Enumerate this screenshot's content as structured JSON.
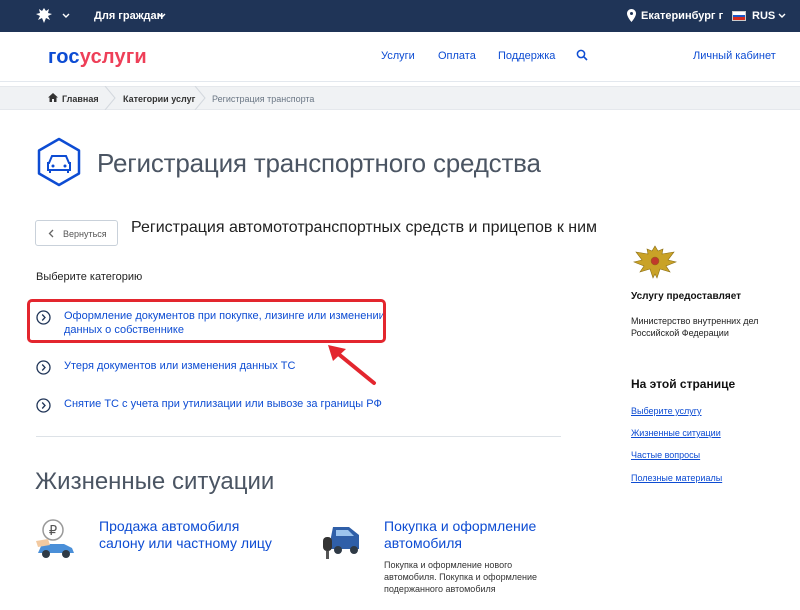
{
  "topbar": {
    "for_citizens": "Для граждан",
    "city": "Екатеринбург г",
    "lang": "RUS"
  },
  "header": {
    "logo_part1": "гос",
    "logo_part2": "услуги",
    "nav": [
      "Услуги",
      "Оплата",
      "Поддержка"
    ],
    "cabinet": "Личный кабинет"
  },
  "breadcrumb": [
    "Главная",
    "Категории услуг",
    "Регистрация транспорта"
  ],
  "page": {
    "title": "Регистрация транспортного средства",
    "back_label": "Вернуться",
    "subtitle": "Регистрация автомототранспортных средств и прицепов к ним",
    "choose_label": "Выберите категорию",
    "options": [
      {
        "line1": "Оформление документов при покупке, лизинге или изменении",
        "line2": "данных о собственнике"
      },
      {
        "line1": "Утеря документов или изменения данных ТС",
        "line2": ""
      },
      {
        "line1": "Снятие ТС с учета при утилизации или вывозе за границы РФ",
        "line2": ""
      }
    ],
    "life_title": "Жизненные ситуации",
    "cards": [
      {
        "title1": "Продажа автомобиля",
        "title2": "салону или частному лицу",
        "desc": [
          "",
          "",
          ""
        ]
      },
      {
        "title1": "Покупка и оформление",
        "title2": "автомобиля",
        "desc": [
          "Покупка и оформление нового",
          "автомобиля. Покупка и оформление",
          "подержанного автомобиля"
        ]
      }
    ]
  },
  "sidebar": {
    "provider_label": "Услугу предоставляет",
    "provider_line1": "Министерство внутренних дел",
    "provider_line2": "Российской Федерации",
    "on_page": "На этой странице",
    "links": [
      "Выберите услугу",
      "Жизненные ситуации",
      "Частые вопросы",
      "Полезные материалы"
    ]
  },
  "colors": {
    "topbar": "#1f3457",
    "link": "#0d4cd3",
    "logo_red": "#ee3f58",
    "highlight": "#e3262e"
  },
  "icons": [
    "emblem-icon",
    "chevron-down-icon",
    "location-pin-icon",
    "flag-icon",
    "search-icon",
    "home-icon",
    "car-icon",
    "chevron-left-icon",
    "chevron-right-circle-icon",
    "red-arrow-icon",
    "eagle-emblem-icon",
    "ruble-car-icon",
    "car-key-icon"
  ]
}
